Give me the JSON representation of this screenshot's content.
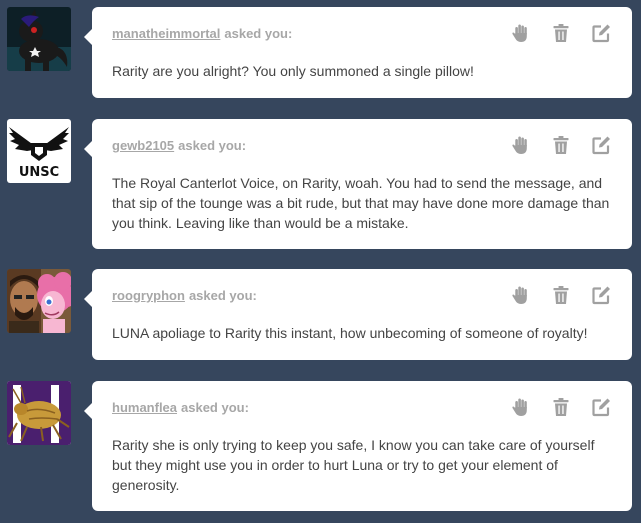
{
  "colors": {
    "background": "#36465d",
    "card": "#ffffff",
    "meta_text": "#a7a7a7",
    "body_text": "#444444",
    "icon": "#a0a0a0"
  },
  "icons": {
    "block": "hand-icon",
    "delete": "trash-icon",
    "answer": "edit-icon"
  },
  "asks": [
    {
      "asker": "manatheimmortal",
      "suffix": "asked you:",
      "question": "Rarity are you alright? You only summoned a single pillow!"
    },
    {
      "asker": "gewb2105",
      "suffix": "asked you:",
      "question": "The Royal Canterlot Voice, on Rarity, woah. You had to send the message, and that sip of the tounge was a bit rude, but that may have done more damage than you think. Leaving like than would be a mistake.",
      "avatar_text": "UNSC"
    },
    {
      "asker": "roogryphon",
      "suffix": "asked you:",
      "question": "LUNA apoliage to Rarity this instant, how unbecoming of someone of royalty!"
    },
    {
      "asker": "humanflea",
      "suffix": "asked you:",
      "question": "Rarity she is only trying to keep you safe, I know you can take care of yourself but they might use you in order to hurt Luna or try to get your element of generosity."
    }
  ]
}
